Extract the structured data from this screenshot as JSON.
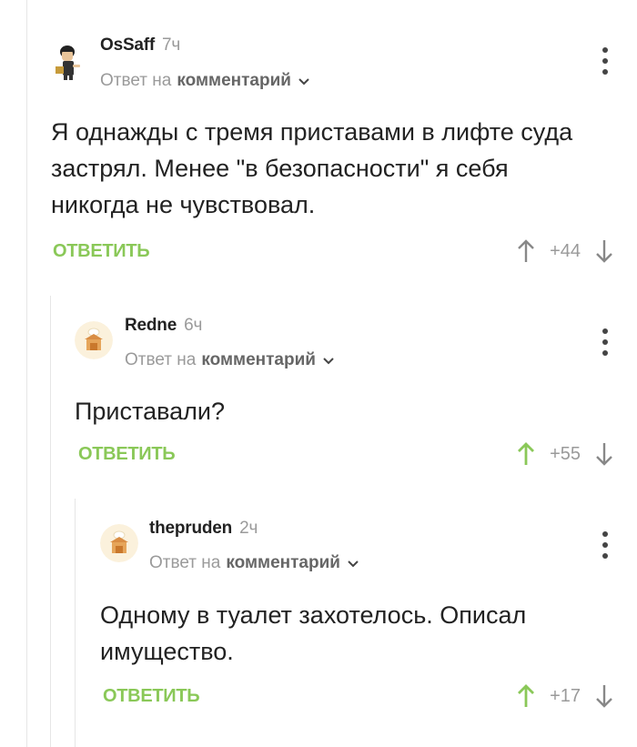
{
  "comments": [
    {
      "author": "OsSaff",
      "time": "7ч",
      "reply_prefix": "Ответ на",
      "reply_target": "комментарий",
      "text": "Я однажды с тремя приставами в лифте суда застрял. Менее \"в безопасности\" я себя никогда не чувствовал.",
      "reply_label": "ОТВЕТИТЬ",
      "rating": "+44",
      "upvoted": false
    },
    {
      "author": "Redne",
      "time": "6ч",
      "reply_prefix": "Ответ на",
      "reply_target": "комментарий",
      "text": "Приставали?",
      "reply_label": "ОТВЕТИТЬ",
      "rating": "+55",
      "upvoted": true
    },
    {
      "author": "thepruden",
      "time": "2ч",
      "reply_prefix": "Ответ на",
      "reply_target": "комментарий",
      "text": "Одному в туалет захотелось. Описал имущество.",
      "reply_label": "ОТВЕТИТЬ",
      "rating": "+17",
      "upvoted": true
    }
  ],
  "colors": {
    "accent_green": "#8ac858",
    "muted_gray": "#9a9a9a"
  },
  "icons": [
    "user-avatar-icon",
    "chevron-down-icon",
    "more-vertical-icon",
    "arrow-up-icon",
    "arrow-down-icon"
  ]
}
